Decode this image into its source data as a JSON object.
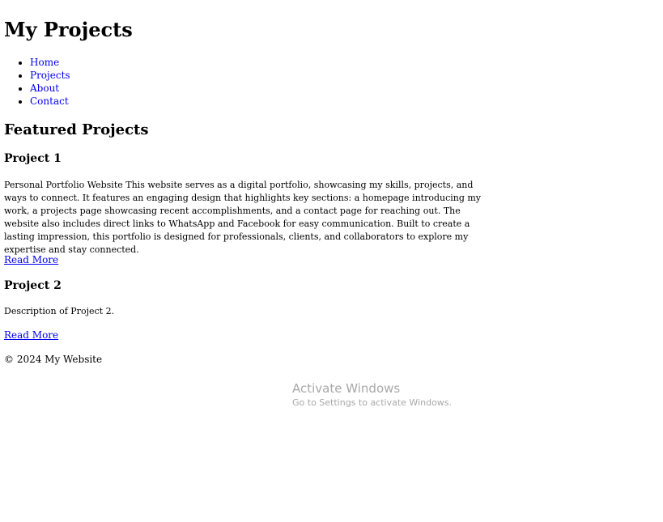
{
  "header": {
    "title": "My Projects"
  },
  "nav": {
    "items": [
      {
        "label": "Home"
      },
      {
        "label": "Projects"
      },
      {
        "label": "About"
      },
      {
        "label": "Contact"
      }
    ]
  },
  "main": {
    "section_title": "Featured Projects",
    "projects": [
      {
        "title": "Project 1",
        "description": "Personal Portfolio Website This website serves as a digital portfolio, showcasing my skills, projects, and ways to connect. It features an engaging design that highlights key sections: a homepage introducing my work, a projects page showcasing recent accomplishments, and a contact page for reaching out. The website also includes direct links to WhatsApp and Facebook for easy communication. Built to create a lasting impression, this portfolio is designed for professionals, clients, and collaborators to explore my expertise and stay connected.",
        "link_label": "Read More"
      },
      {
        "title": "Project 2",
        "description": "Description of Project 2.",
        "link_label": "Read More"
      }
    ]
  },
  "footer": {
    "text": "© 2024 My Website"
  },
  "os_watermark": {
    "title": "Activate Windows",
    "subtitle": "Go to Settings to activate Windows."
  }
}
